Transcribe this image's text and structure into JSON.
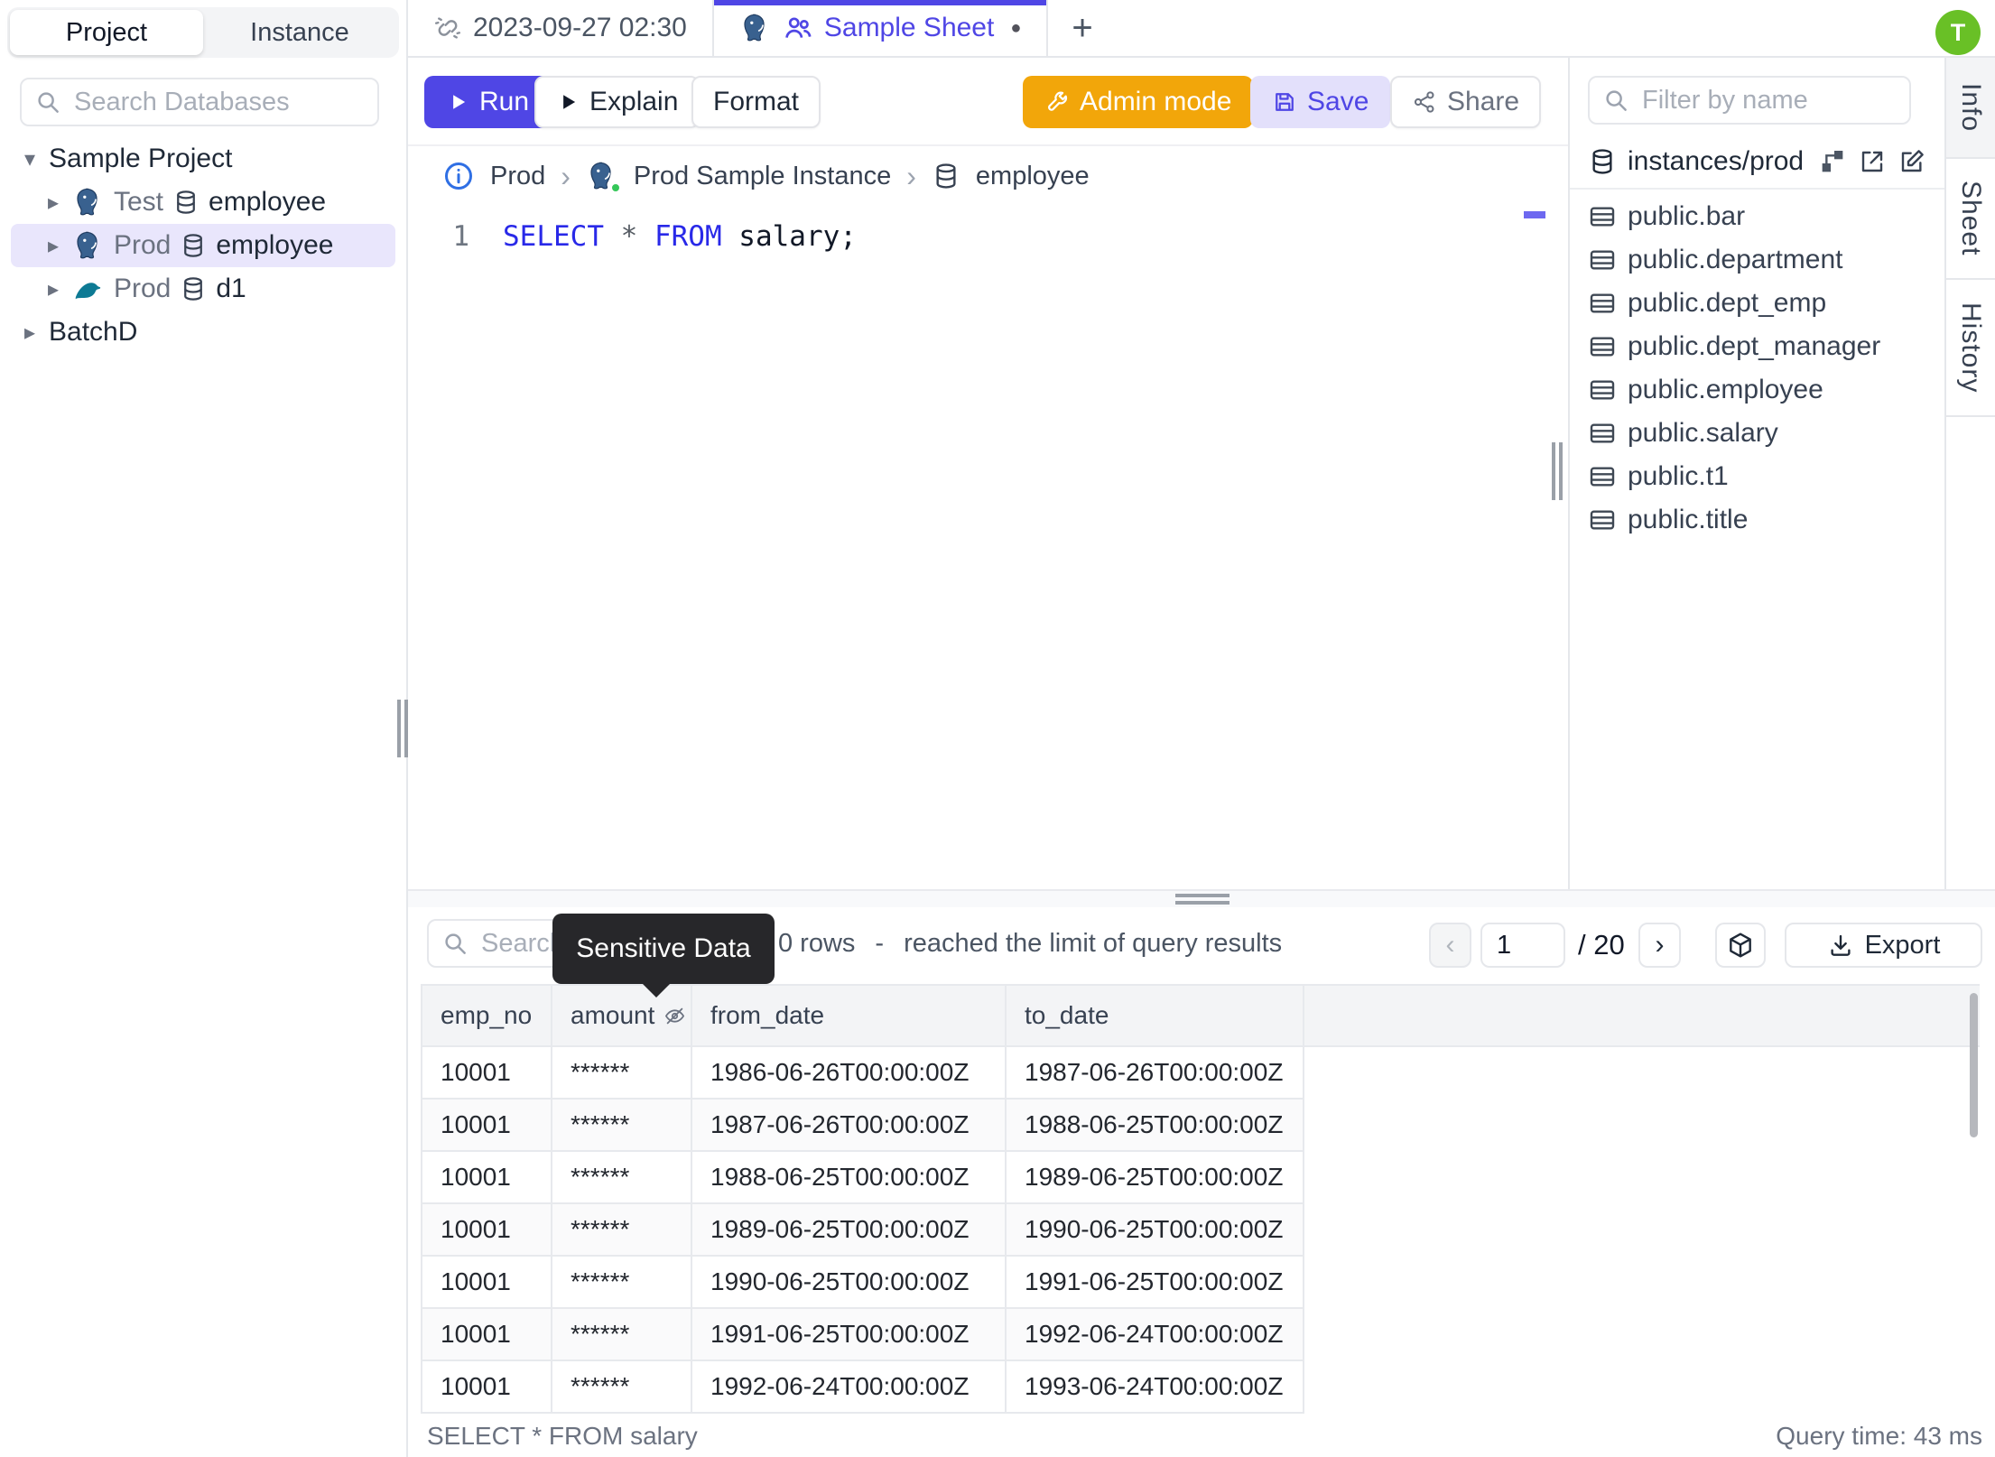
{
  "colors": {
    "accent_indigo": "#4f46e5",
    "admin_orange": "#f2a60a",
    "save_button_bg": "#e3e0fb",
    "selected_tree_row_bg": "#e9e6fc",
    "avatar_green": "#69c026",
    "tooltip_bg": "#27272a",
    "sql_keyword_blue": "#2929e8",
    "active_tab_border": "#4f46e5"
  },
  "icons": {
    "caret_down": "▾",
    "caret_right": "▸",
    "breadcrumb_chevron": "›",
    "prev_chevron": "‹",
    "next_chevron": "›",
    "plus": "+",
    "dirty_dot": "●"
  },
  "left_panel": {
    "tabs": [
      {
        "label": "Project"
      },
      {
        "label": "Instance"
      }
    ],
    "search_placeholder": "Search Databases",
    "project_label": "Sample Project",
    "rows": [
      {
        "env": "Test",
        "db": "employee",
        "engine": "postgres"
      },
      {
        "env": "Prod",
        "db": "employee",
        "engine": "postgres"
      },
      {
        "env": "Prod",
        "db": "d1",
        "engine": "mysql"
      }
    ],
    "batch_label": "BatchD"
  },
  "tab_bar": {
    "tab1_label": "2023-09-27 02:30",
    "tab2_label": "Sample Sheet"
  },
  "toolbar": {
    "run_label": "Run",
    "explain_label": "Explain",
    "format_label": "Format",
    "admin_label": "Admin mode",
    "save_label": "Save",
    "share_label": "Share"
  },
  "breadcrumb": {
    "env": "Prod",
    "instance": "Prod Sample Instance",
    "database": "employee"
  },
  "editor": {
    "line_number": "1",
    "kw_select": "SELECT",
    "star": " * ",
    "kw_from": "FROM",
    "rest": " salary;"
  },
  "right_panel": {
    "filter_placeholder": "Filter by name",
    "source": "instances/prod",
    "tables": [
      "public.bar",
      "public.department",
      "public.dept_emp",
      "public.dept_manager",
      "public.employee",
      "public.salary",
      "public.t1",
      "public.title"
    ]
  },
  "right_rail": {
    "tabs": [
      "Info",
      "Sheet",
      "History"
    ]
  },
  "results": {
    "search_placeholder": "Search",
    "tooltip": "Sensitive Data",
    "rows_count": "0 rows",
    "dash": "-",
    "limit_note": "reached the limit of query results",
    "page": "1",
    "page_total": "/ 20",
    "export_label": "Export",
    "columns": [
      "emp_no",
      "amount",
      "from_date",
      "to_date"
    ],
    "rows": [
      [
        "10001",
        "******",
        "1986-06-26T00:00:00Z",
        "1987-06-26T00:00:00Z"
      ],
      [
        "10001",
        "******",
        "1987-06-26T00:00:00Z",
        "1988-06-25T00:00:00Z"
      ],
      [
        "10001",
        "******",
        "1988-06-25T00:00:00Z",
        "1989-06-25T00:00:00Z"
      ],
      [
        "10001",
        "******",
        "1989-06-25T00:00:00Z",
        "1990-06-25T00:00:00Z"
      ],
      [
        "10001",
        "******",
        "1990-06-25T00:00:00Z",
        "1991-06-25T00:00:00Z"
      ],
      [
        "10001",
        "******",
        "1991-06-25T00:00:00Z",
        "1992-06-24T00:00:00Z"
      ],
      [
        "10001",
        "******",
        "1992-06-24T00:00:00Z",
        "1993-06-24T00:00:00Z"
      ]
    ],
    "status_query": "SELECT * FROM salary",
    "status_time": "Query time: 43 ms"
  },
  "avatar": {
    "initial": "T"
  }
}
